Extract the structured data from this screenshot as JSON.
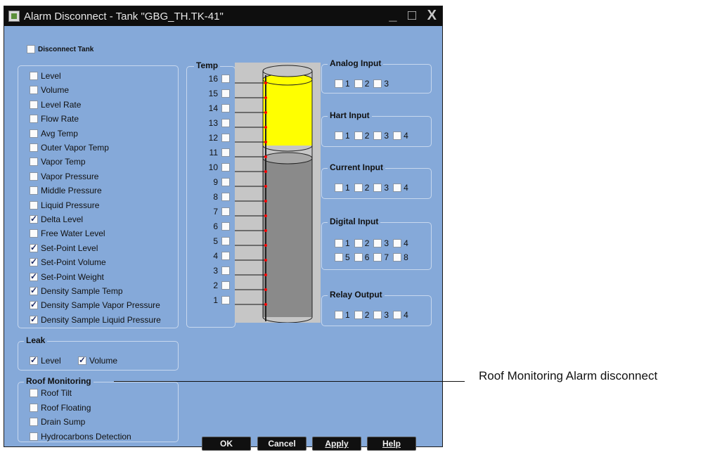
{
  "window": {
    "title": "Alarm Disconnect - Tank \"GBG_TH.TK-41\"",
    "controls": [
      "_",
      "□",
      "X"
    ]
  },
  "disconnect_tank": {
    "label": "Disconnect Tank",
    "checked": false
  },
  "alarms": [
    {
      "label": "Level",
      "checked": false
    },
    {
      "label": "Volume",
      "checked": false
    },
    {
      "label": "Level Rate",
      "checked": false
    },
    {
      "label": "Flow Rate",
      "checked": false
    },
    {
      "label": "Avg Temp",
      "checked": false
    },
    {
      "label": "Outer Vapor Temp",
      "checked": false
    },
    {
      "label": "Vapor Temp",
      "checked": false
    },
    {
      "label": "Vapor Pressure",
      "checked": false
    },
    {
      "label": "Middle Pressure",
      "checked": false
    },
    {
      "label": "Liquid Pressure",
      "checked": false
    },
    {
      "label": "Delta Level",
      "checked": true
    },
    {
      "label": "Free  Water Level",
      "checked": false
    },
    {
      "label": "Set-Point Level",
      "checked": true
    },
    {
      "label": "Set-Point Volume",
      "checked": true
    },
    {
      "label": "Set-Point Weight",
      "checked": true
    },
    {
      "label": "Density Sample Temp",
      "checked": true
    },
    {
      "label": "Density Sample Vapor Pressure",
      "checked": true
    },
    {
      "label": "Density Sample Liquid Pressure",
      "checked": true
    }
  ],
  "leak": {
    "title": "Leak",
    "items": [
      {
        "label": "Level",
        "checked": true
      },
      {
        "label": "Volume",
        "checked": true
      }
    ]
  },
  "roof": {
    "title": "Roof Monitoring",
    "items": [
      {
        "label": "Roof Tilt",
        "checked": false
      },
      {
        "label": "Roof Floating",
        "checked": false
      },
      {
        "label": "Drain Sump",
        "checked": false
      },
      {
        "label": "Hydrocarbons Detection",
        "checked": false
      }
    ]
  },
  "temp": {
    "title": "Temp",
    "labels": [
      "16",
      "15",
      "14",
      "13",
      "12",
      "11",
      "10",
      "9",
      "8",
      "7",
      "6",
      "5",
      "4",
      "3",
      "2",
      "1"
    ]
  },
  "io": {
    "analog": {
      "title": "Analog Input",
      "items": [
        "1",
        "2",
        "3"
      ]
    },
    "hart": {
      "title": "Hart Input",
      "items": [
        "1",
        "2",
        "3",
        "4"
      ]
    },
    "current": {
      "title": "Current Input",
      "items": [
        "1",
        "2",
        "3",
        "4"
      ]
    },
    "digital": {
      "title": "Digital Input",
      "row1": [
        "1",
        "2",
        "3",
        "4"
      ],
      "row2": [
        "5",
        "6",
        "7",
        "8"
      ]
    },
    "relay": {
      "title": "Relay Output",
      "items": [
        "1",
        "2",
        "3",
        "4"
      ]
    }
  },
  "buttons": {
    "ok": "OK",
    "cancel": "Cancel",
    "apply": "Apply",
    "help": "Help"
  },
  "callout": "Roof Monitoring Alarm disconnect",
  "colors": {
    "window_bg": "#85a9d9",
    "titlebar": "#0e0e0e",
    "product_fill": "#ffff00",
    "liquid_fill": "#8a8a8a",
    "sensor_dot": "#ff0000"
  }
}
